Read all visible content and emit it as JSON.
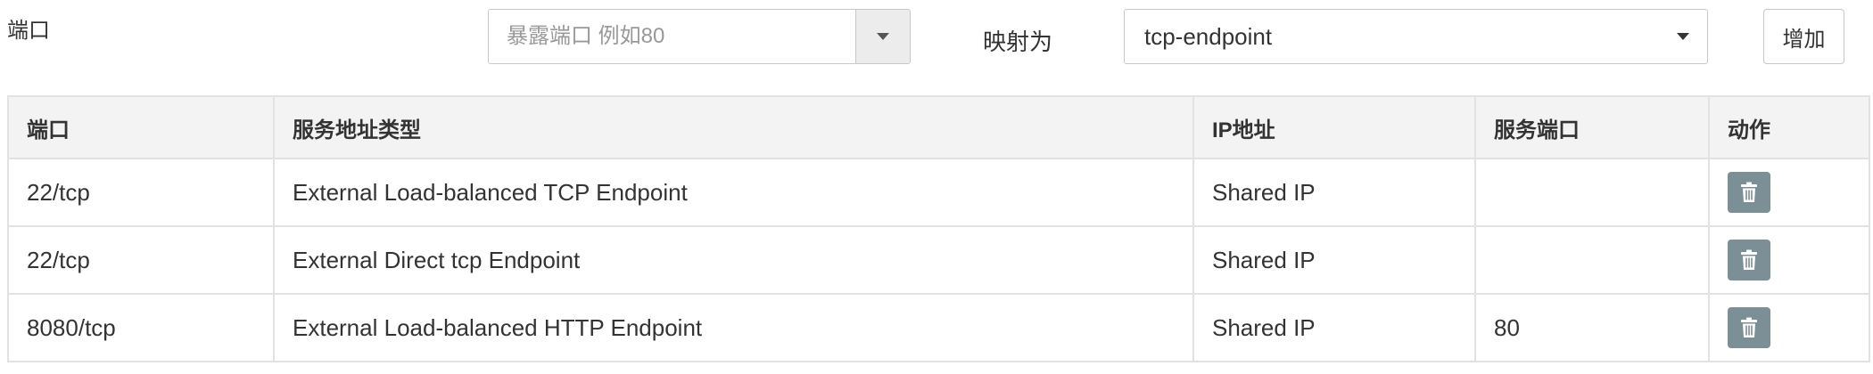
{
  "form": {
    "port_label": "端口",
    "port_placeholder": "暴露端口 例如80",
    "map_label": "映射为",
    "map_value": "tcp-endpoint",
    "add_label": "增加"
  },
  "table": {
    "headers": [
      "端口",
      "服务地址类型",
      "IP地址",
      "服务端口",
      "动作"
    ],
    "rows": [
      {
        "port": "22/tcp",
        "type": "External Load-balanced TCP Endpoint",
        "ip": "Shared IP",
        "service_port": ""
      },
      {
        "port": "22/tcp",
        "type": "External Direct tcp Endpoint",
        "ip": "Shared IP",
        "service_port": ""
      },
      {
        "port": "8080/tcp",
        "type": "External Load-balanced HTTP Endpoint",
        "ip": "Shared IP",
        "service_port": "80"
      }
    ]
  },
  "icons": {
    "dropdown": "chevron-down-icon",
    "delete": "trash-icon"
  },
  "colors": {
    "delete_button": "#7a8f96",
    "header_bg": "#f3f3f3",
    "border": "#e2e2e2"
  }
}
